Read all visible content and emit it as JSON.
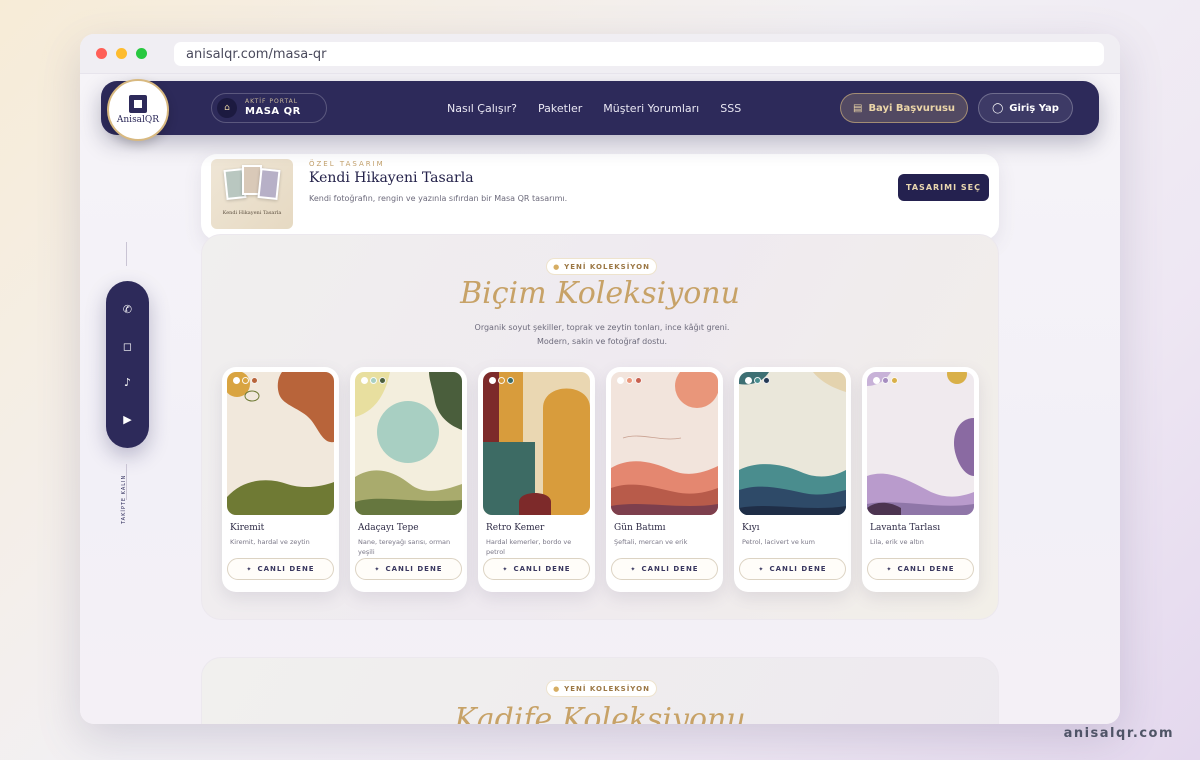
{
  "browser": {
    "url": "anisalqr.com/masa-qr",
    "traffic_lights": [
      "#ff5f57",
      "#febc2e",
      "#28c840"
    ]
  },
  "watermark": "anisalqr.com",
  "navbar": {
    "logo_text": "AnisalQR",
    "portal_kicker": "AKTİF PORTAL",
    "portal_name": "MASA QR",
    "links": [
      "Nasıl Çalışır?",
      "Paketler",
      "Müşteri Yorumları",
      "SSS"
    ],
    "bayi_label": "Bayi Başvurusu",
    "giris_label": "Giriş Yap"
  },
  "custom_design": {
    "kicker": "ÖZEL TASARIM",
    "title": "Kendi Hikayeni Tasarla",
    "description": "Kendi fotoğrafın, rengin ve yazınla sıfırdan bir Masa QR tasarımı.",
    "thumb_text": "Kendi Hikayeni Tasarla",
    "button": "TASARIMI SEÇ"
  },
  "social": {
    "icons": [
      "whatsapp-icon",
      "instagram-icon",
      "tiktok-icon",
      "youtube-icon"
    ],
    "follow_text": "TAKİPTE KALIN"
  },
  "collection": {
    "badge": "YENİ KOLEKSİYON",
    "title": "Biçim Koleksiyonu",
    "description_line1": "Organik soyut şekiller, toprak ve zeytin tonları, ince kâğıt greni.",
    "description_line2": "Modern, sakin ve fotoğraf dostu.",
    "cards": [
      {
        "name": "Kiremit",
        "description": "Kiremit, hardal ve zeytin",
        "button": "CANLI DENE",
        "palette": [
          "#ffffff",
          "#d9a441",
          "#b8643a"
        ]
      },
      {
        "name": "Adaçayı Tepe",
        "description": "Nane, tereyağı sarısı, orman yeşili",
        "button": "CANLI DENE",
        "palette": [
          "#ffffff",
          "#a8cfc2",
          "#4a5e3c"
        ]
      },
      {
        "name": "Retro Kemer",
        "description": "Hardal kemerler, bordo ve petrol",
        "button": "CANLI DENE",
        "palette": [
          "#ffffff",
          "#d89c3c",
          "#3d6b64"
        ]
      },
      {
        "name": "Gün Batımı",
        "description": "Şeftali, mercan ve erik",
        "button": "CANLI DENE",
        "palette": [
          "#ffffff",
          "#e9967a",
          "#c8604e"
        ]
      },
      {
        "name": "Kıyı",
        "description": "Petrol, lacivert ve kum",
        "button": "CANLI DENE",
        "palette": [
          "#ffffff",
          "#4a8d8e",
          "#243a55"
        ]
      },
      {
        "name": "Lavanta Tarlası",
        "description": "Lila, erik ve altın",
        "button": "CANLI DENE",
        "palette": [
          "#ffffff",
          "#a58cbf",
          "#d9b048"
        ]
      }
    ]
  },
  "collection2": {
    "badge": "YENİ KOLEKSİYON",
    "title": "Kadife Koleksiyonu"
  }
}
